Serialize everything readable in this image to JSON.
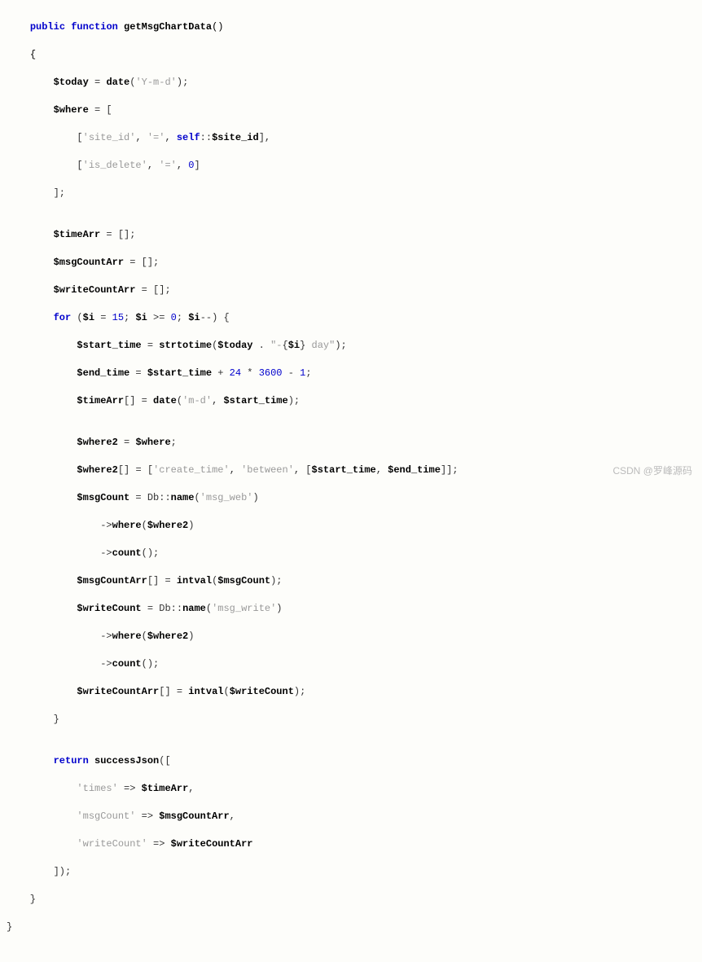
{
  "code": {
    "l01_kw1": "public",
    "l01_kw2": "function",
    "l01_fn": "getMsgChartData",
    "l01_p": "()",
    "l02": "{",
    "l03_var": "$today",
    "l03_eq": " = ",
    "l03_fn": "date",
    "l03_op": "(",
    "l03_str": "'Y-m-d'",
    "l03_cp": ");",
    "l04_var": "$where",
    "l04_rest": " = [",
    "l05_pre": "            [",
    "l05_str1": "'site_id'",
    "l05_c1": ", ",
    "l05_str2": "'='",
    "l05_c2": ", ",
    "l05_self": "self",
    "l05_dc": "::",
    "l05_var": "$site_id",
    "l05_end": "],",
    "l06_pre": "            [",
    "l06_str1": "'is_delete'",
    "l06_c1": ", ",
    "l06_str2": "'='",
    "l06_c2": ", ",
    "l06_num": "0",
    "l06_end": "]",
    "l07": "        ];",
    "l08": "",
    "l09_var": "$timeArr",
    "l09_rest": " = [];",
    "l10_var": "$msgCountArr",
    "l10_rest": " = [];",
    "l11_var": "$writeCountArr",
    "l11_rest": " = [];",
    "l12_kw": "for",
    "l12_op": " (",
    "l12_v1": "$i",
    "l12_eq": " = ",
    "l12_n1": "15",
    "l12_sc": "; ",
    "l12_v2": "$i",
    "l12_ge": " >= ",
    "l12_n2": "0",
    "l12_sc2": "; ",
    "l12_v3": "$i",
    "l12_dec": "--) {",
    "l13_var": "$start_time",
    "l13_eq": " = ",
    "l13_fn": "strtotime",
    "l13_op": "(",
    "l13_var2": "$today",
    "l13_cat": " . ",
    "l13_str1": "\"-",
    "l13_br1": "{",
    "l13_var3": "$i",
    "l13_br2": "}",
    "l13_str2": " day\"",
    "l13_cp": ");",
    "l14_var": "$end_time",
    "l14_eq": " = ",
    "l14_var2": "$start_time",
    "l14_plus": " + ",
    "l14_n1": "24",
    "l14_mul": " * ",
    "l14_n2": "3600",
    "l14_min": " - ",
    "l14_n3": "1",
    "l14_sc": ";",
    "l15_var": "$timeArr",
    "l15_br": "[] = ",
    "l15_fn": "date",
    "l15_op": "(",
    "l15_str": "'m-d'",
    "l15_c": ", ",
    "l15_var2": "$start_time",
    "l15_cp": ");",
    "l16": "",
    "l17_var": "$where2",
    "l17_eq": " = ",
    "l17_var2": "$where",
    "l17_sc": ";",
    "l18_var": "$where2",
    "l18_br": "[] = [",
    "l18_str1": "'create_time'",
    "l18_c1": ", ",
    "l18_str2": "'between'",
    "l18_c2": ", [",
    "l18_var2": "$start_time",
    "l18_c3": ", ",
    "l18_var3": "$end_time",
    "l18_end": "]];",
    "l19_var": "$msgCount",
    "l19_eq": " = Db::",
    "l19_fn": "name",
    "l19_op": "(",
    "l19_str": "'msg_web'",
    "l19_cp": ")",
    "l20_arrow": "                ->",
    "l20_fn": "where",
    "l20_op": "(",
    "l20_var": "$where2",
    "l20_cp": ")",
    "l21_arrow": "                ->",
    "l21_fn": "count",
    "l21_cp": "();",
    "l22_var": "$msgCountArr",
    "l22_br": "[] = ",
    "l22_fn": "intval",
    "l22_op": "(",
    "l22_var2": "$msgCount",
    "l22_cp": ");",
    "l23_var": "$writeCount",
    "l23_eq": " = Db::",
    "l23_fn": "name",
    "l23_op": "(",
    "l23_str": "'msg_write'",
    "l23_cp": ")",
    "l24_arrow": "                ->",
    "l24_fn": "where",
    "l24_op": "(",
    "l24_var": "$where2",
    "l24_cp": ")",
    "l25_arrow": "                ->",
    "l25_fn": "count",
    "l25_cp": "();",
    "l26_var": "$writeCountArr",
    "l26_br": "[] = ",
    "l26_fn": "intval",
    "l26_op": "(",
    "l26_var2": "$writeCount",
    "l26_cp": ");",
    "l27": "        }",
    "l28": "",
    "l29_kw": "return",
    "l29_fn": " successJson",
    "l29_op": "([",
    "l30_pre": "            ",
    "l30_str": "'times'",
    "l30_ar": " => ",
    "l30_var": "$timeArr",
    "l30_c": ",",
    "l31_pre": "            ",
    "l31_str": "'msgCount'",
    "l31_ar": " => ",
    "l31_var": "$msgCountArr",
    "l31_c": ",",
    "l32_pre": "            ",
    "l32_str": "'writeCount'",
    "l32_ar": " => ",
    "l32_var": "$writeCountArr",
    "l33": "        ]);",
    "l34": "    }",
    "l35": "}"
  },
  "watermark": "CSDN @罗峰源码"
}
